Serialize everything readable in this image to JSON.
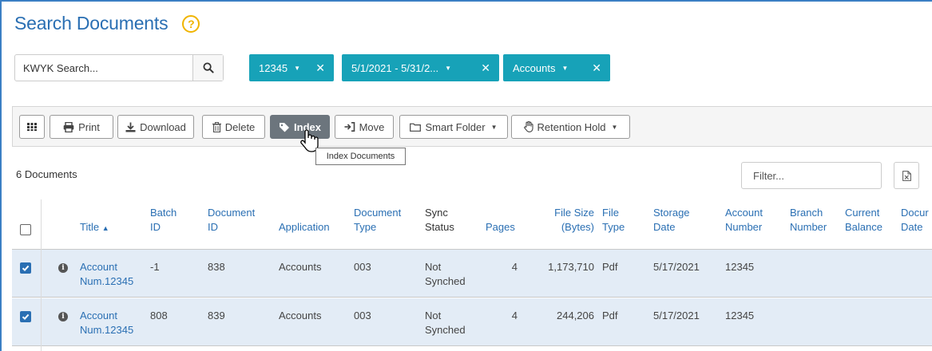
{
  "header": {
    "title": "Search Documents",
    "help_icon": "question-circle-icon"
  },
  "search": {
    "placeholder": "KWYK Search..."
  },
  "filters": [
    {
      "label": "12345"
    },
    {
      "label": "5/1/2021 - 5/31/2..."
    },
    {
      "label": "Accounts"
    }
  ],
  "toolbar": {
    "columns_icon": "grid-icon",
    "print": "Print",
    "download": "Download",
    "delete": "Delete",
    "index": "Index",
    "move": "Move",
    "smart_folder": "Smart Folder",
    "retention_hold": "Retention Hold"
  },
  "tooltip": "Index Documents",
  "results": {
    "count_label": "6 Documents",
    "filter_placeholder": "Filter..."
  },
  "table": {
    "columns": {
      "title": "Title",
      "batch_id": [
        "Batch",
        "ID"
      ],
      "document_id": [
        "Document",
        "ID"
      ],
      "application": "Application",
      "document_type": [
        "Document",
        "Type"
      ],
      "sync_status": [
        "Sync",
        "Status"
      ],
      "pages": "Pages",
      "file_size": [
        "File Size",
        "(Bytes)"
      ],
      "file_type": [
        "File",
        "Type"
      ],
      "storage_date": [
        "Storage",
        "Date"
      ],
      "account_number": [
        "Account",
        "Number"
      ],
      "branch_number": [
        "Branch",
        "Number"
      ],
      "current_balance": [
        "Current",
        "Balance"
      ],
      "document_date": [
        "Docur",
        "Date"
      ]
    },
    "rows": [
      {
        "checked": true,
        "title": [
          "Account",
          "Num.12345"
        ],
        "batch_id": "-1",
        "document_id": "838",
        "application": "Accounts",
        "document_type": "003",
        "sync_status": [
          "Not",
          "Synched"
        ],
        "pages": "4",
        "file_size": "1,173,710",
        "file_type": "Pdf",
        "storage_date": "5/17/2021",
        "account_number": "12345"
      },
      {
        "checked": true,
        "title": [
          "Account",
          "Num.12345"
        ],
        "batch_id": "808",
        "document_id": "839",
        "application": "Accounts",
        "document_type": "003",
        "sync_status": [
          "Not",
          "Synched"
        ],
        "pages": "4",
        "file_size": "244,206",
        "file_type": "Pdf",
        "storage_date": "5/17/2021",
        "account_number": "12345"
      }
    ]
  },
  "colors": {
    "accent": "#2a6fb3",
    "chip": "#17a2b8",
    "row_selected": "#e3ecf6",
    "active_button": "#6c757d",
    "help": "#f0b400"
  }
}
